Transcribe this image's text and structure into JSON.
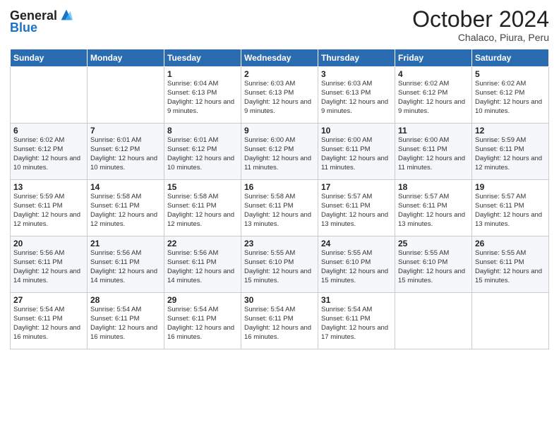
{
  "logo": {
    "general": "General",
    "blue": "Blue"
  },
  "title": "October 2024",
  "subtitle": "Chalaco, Piura, Peru",
  "weekdays": [
    "Sunday",
    "Monday",
    "Tuesday",
    "Wednesday",
    "Thursday",
    "Friday",
    "Saturday"
  ],
  "weeks": [
    [
      {
        "day": "",
        "info": ""
      },
      {
        "day": "",
        "info": ""
      },
      {
        "day": "1",
        "info": "Sunrise: 6:04 AM\nSunset: 6:13 PM\nDaylight: 12 hours and 9 minutes."
      },
      {
        "day": "2",
        "info": "Sunrise: 6:03 AM\nSunset: 6:13 PM\nDaylight: 12 hours and 9 minutes."
      },
      {
        "day": "3",
        "info": "Sunrise: 6:03 AM\nSunset: 6:13 PM\nDaylight: 12 hours and 9 minutes."
      },
      {
        "day": "4",
        "info": "Sunrise: 6:02 AM\nSunset: 6:12 PM\nDaylight: 12 hours and 9 minutes."
      },
      {
        "day": "5",
        "info": "Sunrise: 6:02 AM\nSunset: 6:12 PM\nDaylight: 12 hours and 10 minutes."
      }
    ],
    [
      {
        "day": "6",
        "info": "Sunrise: 6:02 AM\nSunset: 6:12 PM\nDaylight: 12 hours and 10 minutes."
      },
      {
        "day": "7",
        "info": "Sunrise: 6:01 AM\nSunset: 6:12 PM\nDaylight: 12 hours and 10 minutes."
      },
      {
        "day": "8",
        "info": "Sunrise: 6:01 AM\nSunset: 6:12 PM\nDaylight: 12 hours and 10 minutes."
      },
      {
        "day": "9",
        "info": "Sunrise: 6:00 AM\nSunset: 6:12 PM\nDaylight: 12 hours and 11 minutes."
      },
      {
        "day": "10",
        "info": "Sunrise: 6:00 AM\nSunset: 6:11 PM\nDaylight: 12 hours and 11 minutes."
      },
      {
        "day": "11",
        "info": "Sunrise: 6:00 AM\nSunset: 6:11 PM\nDaylight: 12 hours and 11 minutes."
      },
      {
        "day": "12",
        "info": "Sunrise: 5:59 AM\nSunset: 6:11 PM\nDaylight: 12 hours and 12 minutes."
      }
    ],
    [
      {
        "day": "13",
        "info": "Sunrise: 5:59 AM\nSunset: 6:11 PM\nDaylight: 12 hours and 12 minutes."
      },
      {
        "day": "14",
        "info": "Sunrise: 5:58 AM\nSunset: 6:11 PM\nDaylight: 12 hours and 12 minutes."
      },
      {
        "day": "15",
        "info": "Sunrise: 5:58 AM\nSunset: 6:11 PM\nDaylight: 12 hours and 12 minutes."
      },
      {
        "day": "16",
        "info": "Sunrise: 5:58 AM\nSunset: 6:11 PM\nDaylight: 12 hours and 13 minutes."
      },
      {
        "day": "17",
        "info": "Sunrise: 5:57 AM\nSunset: 6:11 PM\nDaylight: 12 hours and 13 minutes."
      },
      {
        "day": "18",
        "info": "Sunrise: 5:57 AM\nSunset: 6:11 PM\nDaylight: 12 hours and 13 minutes."
      },
      {
        "day": "19",
        "info": "Sunrise: 5:57 AM\nSunset: 6:11 PM\nDaylight: 12 hours and 13 minutes."
      }
    ],
    [
      {
        "day": "20",
        "info": "Sunrise: 5:56 AM\nSunset: 6:11 PM\nDaylight: 12 hours and 14 minutes."
      },
      {
        "day": "21",
        "info": "Sunrise: 5:56 AM\nSunset: 6:11 PM\nDaylight: 12 hours and 14 minutes."
      },
      {
        "day": "22",
        "info": "Sunrise: 5:56 AM\nSunset: 6:11 PM\nDaylight: 12 hours and 14 minutes."
      },
      {
        "day": "23",
        "info": "Sunrise: 5:55 AM\nSunset: 6:10 PM\nDaylight: 12 hours and 15 minutes."
      },
      {
        "day": "24",
        "info": "Sunrise: 5:55 AM\nSunset: 6:10 PM\nDaylight: 12 hours and 15 minutes."
      },
      {
        "day": "25",
        "info": "Sunrise: 5:55 AM\nSunset: 6:10 PM\nDaylight: 12 hours and 15 minutes."
      },
      {
        "day": "26",
        "info": "Sunrise: 5:55 AM\nSunset: 6:11 PM\nDaylight: 12 hours and 15 minutes."
      }
    ],
    [
      {
        "day": "27",
        "info": "Sunrise: 5:54 AM\nSunset: 6:11 PM\nDaylight: 12 hours and 16 minutes."
      },
      {
        "day": "28",
        "info": "Sunrise: 5:54 AM\nSunset: 6:11 PM\nDaylight: 12 hours and 16 minutes."
      },
      {
        "day": "29",
        "info": "Sunrise: 5:54 AM\nSunset: 6:11 PM\nDaylight: 12 hours and 16 minutes."
      },
      {
        "day": "30",
        "info": "Sunrise: 5:54 AM\nSunset: 6:11 PM\nDaylight: 12 hours and 16 minutes."
      },
      {
        "day": "31",
        "info": "Sunrise: 5:54 AM\nSunset: 6:11 PM\nDaylight: 12 hours and 17 minutes."
      },
      {
        "day": "",
        "info": ""
      },
      {
        "day": "",
        "info": ""
      }
    ]
  ]
}
